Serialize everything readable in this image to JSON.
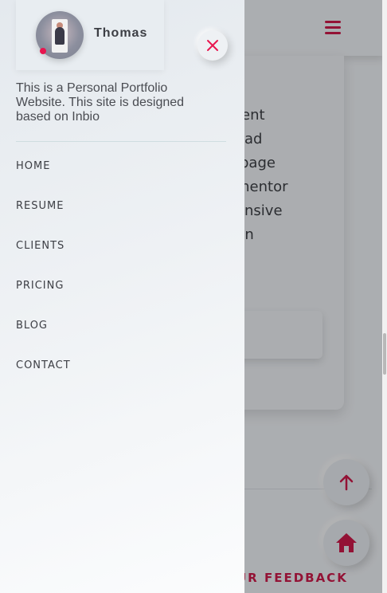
{
  "background": {
    "list_items": [
      "tent",
      "oad",
      "ipage",
      "mentor",
      "onsive",
      "gn"
    ],
    "feedback_text": "UR FEEDBACK",
    "accent_color": "#cc1a4a"
  },
  "sidebar": {
    "profile_name": "Thomas",
    "description": "This is a Personal Portfolio Website. This site is designed based on Inbio",
    "nav": [
      "HOME",
      "RESUME",
      "CLIENTS",
      "PRICING",
      "BLOG",
      "CONTACT"
    ],
    "close_icon": "close-icon",
    "close_color": "#e8164f"
  }
}
